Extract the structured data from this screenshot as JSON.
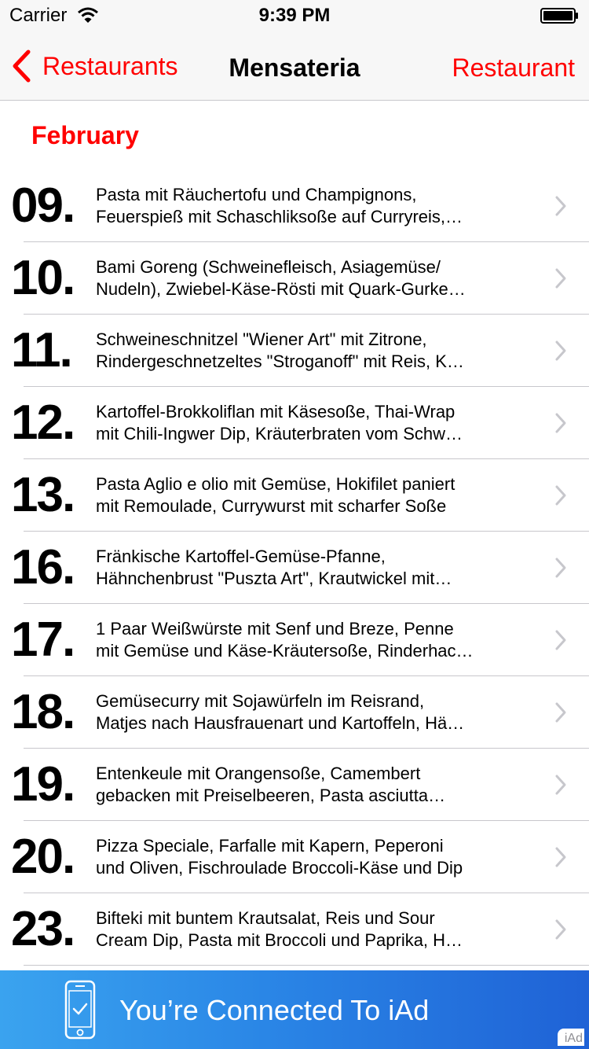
{
  "status_bar": {
    "carrier": "Carrier",
    "time": "9:39 PM"
  },
  "nav": {
    "back_label": "Restaurants",
    "title": "Mensateria",
    "right_label": "Restaurant"
  },
  "section": {
    "title": "February"
  },
  "rows": [
    {
      "day": "09.",
      "line1": "Pasta mit Räuchertofu und Champignons,",
      "line2": "Feuerspieß  mit Schaschliksoße  auf Curryreis,…"
    },
    {
      "day": "10.",
      "line1": "Bami Goreng (Schweinefleisch, Asiagemüse/",
      "line2": "Nudeln), Zwiebel-Käse-Rösti  mit Quark-Gurke…"
    },
    {
      "day": "11.",
      "line1": "Schweineschnitzel \"Wiener Art\"  mit Zitrone,",
      "line2": "Rindergeschnetzeltes \"Stroganoff\" mit Reis, K…"
    },
    {
      "day": "12.",
      "line1": "Kartoffel-Brokkoliflan  mit Käsesoße, Thai-Wrap",
      "line2": "mit Chili-Ingwer Dip, Kräuterbraten vom Schw…"
    },
    {
      "day": "13.",
      "line1": "Pasta Aglio e olio mit Gemüse, Hokifilet paniert",
      "line2": "mit Remoulade, Currywurst  mit scharfer Soße"
    },
    {
      "day": "16.",
      "line1": "Fränkische Kartoffel-Gemüse-Pfanne,",
      "line2": "Hähnchenbrust \"Puszta Art\", Krautwickel  mit…"
    },
    {
      "day": "17.",
      "line1": "1 Paar Weißwürste  mit Senf  und Breze, Penne",
      "line2": "mit Gemüse und Käse-Kräutersoße, Rinderhac…"
    },
    {
      "day": "18.",
      "line1": "Gemüsecurry mit Sojawürfeln im Reisrand,",
      "line2": "Matjes nach Hausfrauenart  und Kartoffeln, Hä…"
    },
    {
      "day": "19.",
      "line1": "Entenkeule mit Orangensoße, Camembert",
      "line2": "gebacken  mit Preiselbeeren, Pasta asciutta…"
    },
    {
      "day": "20.",
      "line1": "Pizza Speciale, Farfalle  mit Kapern, Peperoni",
      "line2": "und Oliven, Fischroulade Broccoli-Käse  und Dip"
    },
    {
      "day": "23.",
      "line1": "Bifteki  mit buntem Krautsalat, Reis  und Sour",
      "line2": "Cream Dip, Pasta  mit Broccoli und Paprika, H…"
    }
  ],
  "banner": {
    "text": "You’re Connected To iAd",
    "badge": "iAd"
  },
  "icons": {
    "back": "chevron-left-icon",
    "disclosure": "chevron-right-icon",
    "phone": "phone-check-icon",
    "wifi": "wifi-icon",
    "battery": "battery-icon"
  },
  "colors": {
    "accent": "#ff0000",
    "bar_background": "#f7f7f7",
    "separator": "#c8c7cc",
    "disclosure": "#c7c7cc",
    "banner_start": "#3aa3ef",
    "banner_end": "#1f62d6"
  }
}
